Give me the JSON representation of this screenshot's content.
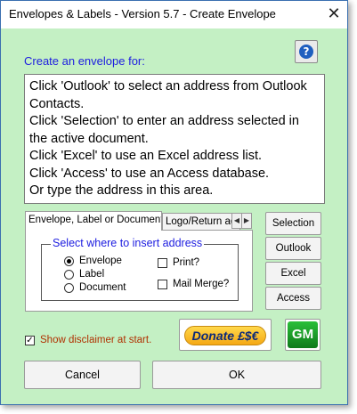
{
  "window": {
    "title": "Envelopes & Labels - Version 5.7 - Create Envelope",
    "close_glyph": "✕"
  },
  "help": {
    "glyph": "?"
  },
  "prompt": {
    "label": "Create an envelope for:"
  },
  "address": {
    "value": "Click 'Outlook' to select an address from Outlook Contacts.\nClick 'Selection' to enter an address selected in the active document.\nClick 'Excel' to use an Excel address list.\nClick 'Access' to use an Access database.\nOr type the address in this area."
  },
  "tabs": [
    {
      "label": "Envelope, Label or Document",
      "active": true
    },
    {
      "label": "Logo/Return address",
      "active": false
    }
  ],
  "tab_scroll": {
    "left": "◀",
    "right": "▶"
  },
  "insert_group": {
    "legend": "Select where to insert address",
    "radios": [
      {
        "label": "Envelope",
        "checked": true
      },
      {
        "label": "Label",
        "checked": false
      },
      {
        "label": "Document",
        "checked": false
      }
    ],
    "checkboxes": [
      {
        "label": "Print?",
        "checked": false
      },
      {
        "label": "Mail Merge?",
        "checked": false
      }
    ]
  },
  "side_buttons": {
    "selection": "Selection",
    "outlook": "Outlook",
    "excel": "Excel",
    "access": "Access"
  },
  "disclaimer": {
    "label": "Show disclaimer at start.",
    "checked": true,
    "check_glyph": "✓"
  },
  "donate": {
    "label": "Donate £$€"
  },
  "gm": {
    "label": "GM"
  },
  "bottom": {
    "cancel": "Cancel",
    "ok": "OK"
  },
  "colors": {
    "background": "#c4f0c4",
    "prompt_text": "#1d1de0",
    "disclaimer_text": "#b03000"
  }
}
